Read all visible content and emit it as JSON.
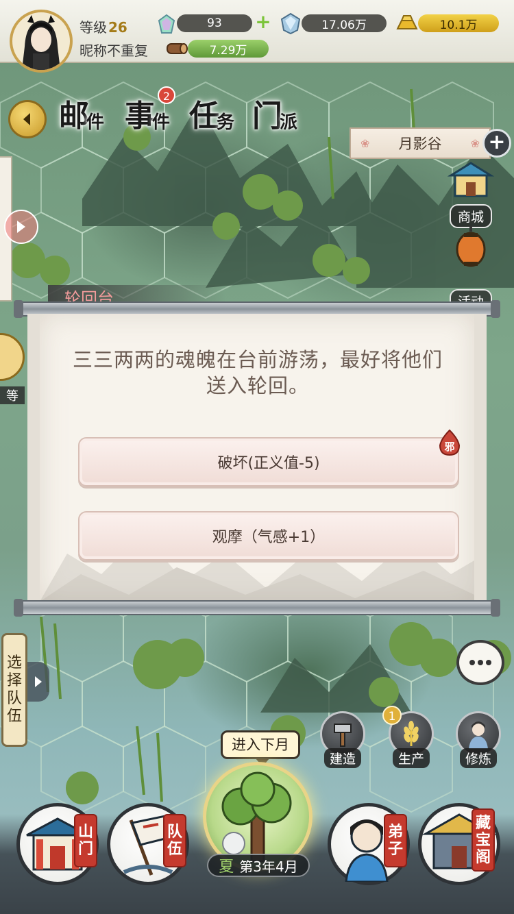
{
  "player": {
    "level_label": "等级",
    "level": "26",
    "nickname": "昵称不重复"
  },
  "resources": {
    "jade": "93",
    "crystal": "17.06万",
    "gold": "10.1万",
    "wood": "7.29万"
  },
  "nav": {
    "mail_big": "邮",
    "mail_small": "件",
    "events_big": "事",
    "events_small": "件",
    "events_badge": "2",
    "tasks_big": "任",
    "tasks_small": "务",
    "sect_big": "门",
    "sect_small": "派"
  },
  "location": {
    "name": "月影谷"
  },
  "side": {
    "shop": "商城",
    "activity": "活动",
    "left_partial": "等"
  },
  "dialog": {
    "title": "轮回台",
    "text": "三三两两的魂魄在台前游荡，最好将他们送入轮回。",
    "choice1": "破坏(正义值-5)",
    "choice1_tag": "邪",
    "choice2": "观摩（气感+1）"
  },
  "team_select": {
    "label_chars": [
      "选",
      "择",
      "队",
      "伍"
    ]
  },
  "actions": {
    "build": "建造",
    "produce": "生产",
    "produce_count": "1",
    "cultivate": "修炼"
  },
  "bottom": {
    "next_month": "进入下月",
    "season": "夏",
    "date": "第3年4月",
    "mountain_gate": [
      "山",
      "门"
    ],
    "team": [
      "队",
      "伍"
    ],
    "disciples": [
      "弟",
      "子"
    ],
    "treasury": [
      "藏",
      "宝",
      "阁"
    ]
  }
}
